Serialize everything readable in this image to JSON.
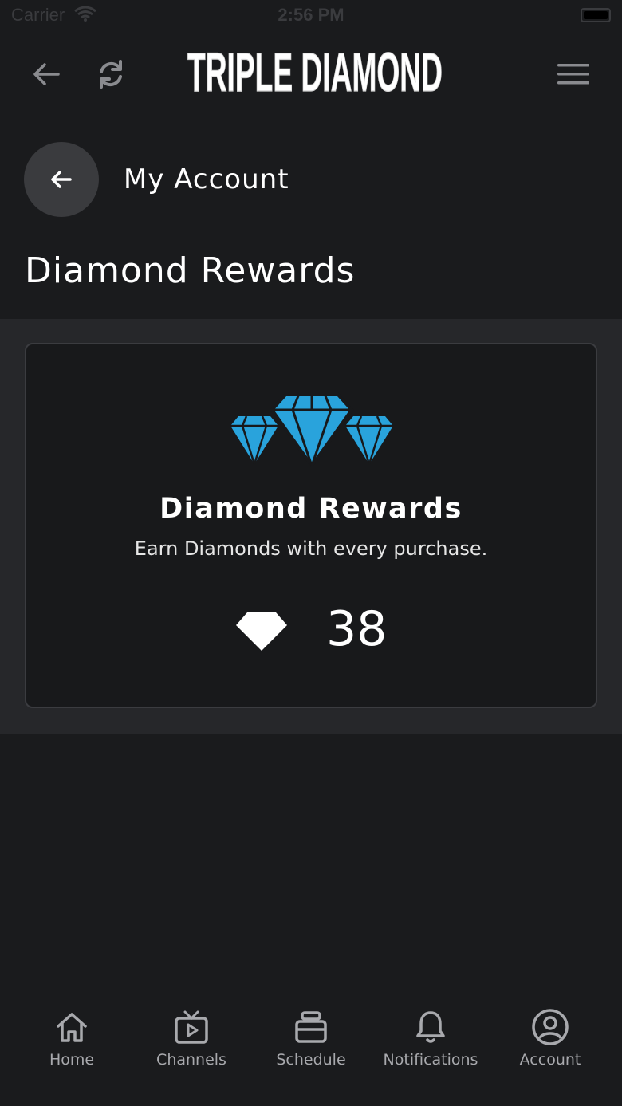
{
  "status_bar": {
    "carrier": "Carrier",
    "time": "2:56 PM"
  },
  "header": {
    "logo_text": "TRIPLE DIAMOND"
  },
  "account": {
    "title": "My Account"
  },
  "page": {
    "title": "Diamond Rewards"
  },
  "rewards_card": {
    "title": "Diamond Rewards",
    "subtitle": "Earn Diamonds with every purchase.",
    "balance": "38"
  },
  "bottom_nav": {
    "items": [
      {
        "label": "Home",
        "icon": "home-icon"
      },
      {
        "label": "Channels",
        "icon": "tv-icon"
      },
      {
        "label": "Schedule",
        "icon": "schedule-icon"
      },
      {
        "label": "Notifications",
        "icon": "bell-icon"
      },
      {
        "label": "Account",
        "icon": "user-circle-icon"
      }
    ]
  },
  "colors": {
    "background": "#1a1b1d",
    "panel": "#26272a",
    "card": "#18191b",
    "accent_diamond": "#29a3dc",
    "nav_text": "#a8a9ad"
  }
}
